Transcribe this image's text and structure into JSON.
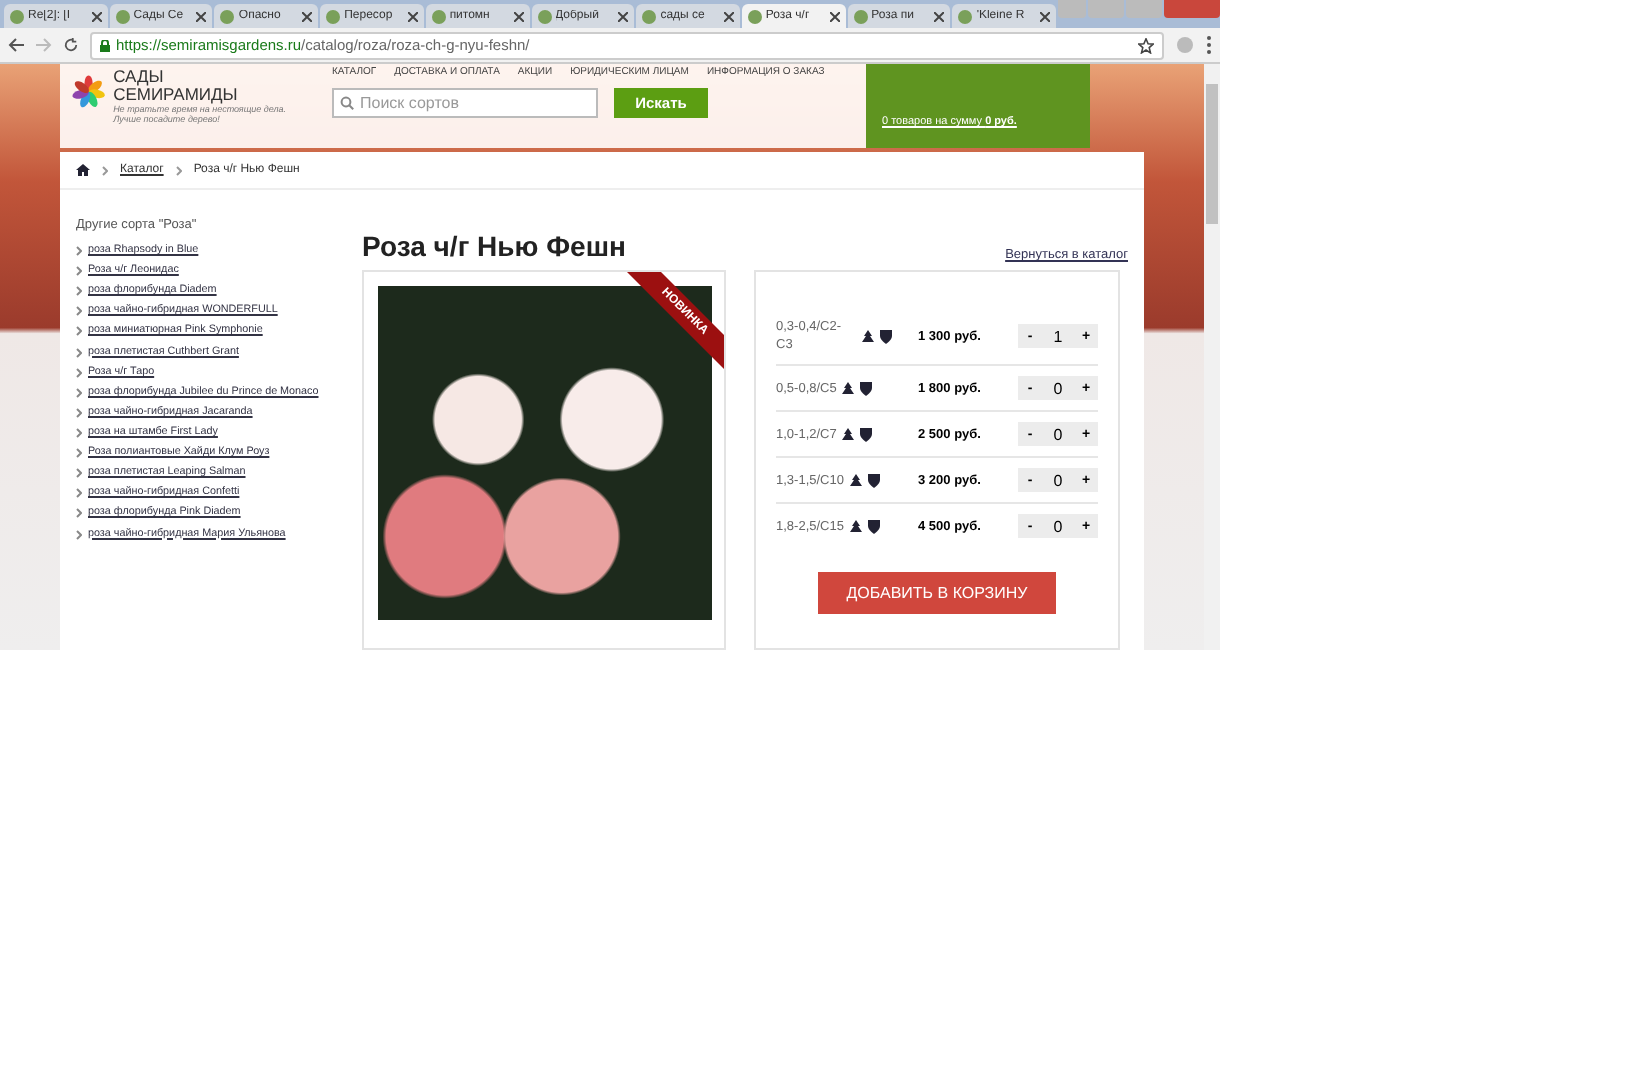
{
  "browser": {
    "tabs": [
      {
        "title": "Re[2]: [І",
        "selected": false
      },
      {
        "title": "Сады Се",
        "selected": false
      },
      {
        "title": "Опасно",
        "selected": false
      },
      {
        "title": "Пересор",
        "selected": false
      },
      {
        "title": "питомн",
        "selected": false
      },
      {
        "title": "Добрый",
        "selected": false
      },
      {
        "title": "сады се",
        "selected": false
      },
      {
        "title": "Роза ч/г",
        "selected": true
      },
      {
        "title": "Роза пи",
        "selected": false
      },
      {
        "title": "'Kleine R",
        "selected": false
      }
    ],
    "url": {
      "host": "https://semiramisgardens.ru",
      "path": "/catalog/roza/roza-ch-g-nyu-feshn/"
    }
  },
  "site_header": {
    "logo_title": "САДЫ СЕМИРАМИДЫ",
    "slogan": "Не тратьте время на нестоящие дела. Лучше посадите дерево!",
    "nav": [
      "КАТАЛОГ",
      "ДОСТАВКА И ОПЛАТА",
      "АКЦИИ",
      "ЮРИДИЧЕСКИМ ЛИЦАМ",
      "ИНФОРМАЦИЯ О ЗАКАЗ"
    ],
    "search": {
      "placeholder": "Поиск сортов",
      "button": "Искать"
    },
    "cart": {
      "summary": "0 товаров на сумму **0 руб.**"
    }
  },
  "breadcrumbs": [
    {
      "label": "Каталог",
      "link": true
    },
    {
      "label": "Роза ч/г Нью Фешн",
      "link": false
    }
  ],
  "sidebar": {
    "title": "Другие сорта \"Роза\"",
    "items": [
      "роза Rhapsody in Blue",
      "Роза ч/г Леонидас",
      "роза флорибунда Diadem",
      "роза чайно-гибридная WONDERFULL",
      "роза миниатюрная Pink Symphonie",
      "роза плетистая Cuthbert Grant",
      "Роза ч/г Таро",
      "роза флорибунда Jubilee du Prince de Monaco",
      "роза чайно-гибридная Jacaranda",
      "роза на штамбе First Lady",
      "Роза полиантовые Хайди Клум Роуз",
      "роза плетистая Leaping Salman",
      "роза чайно-гибридная Confetti",
      "роза флорибунда Pink Diadem",
      "роза чайно-гибридная Мария Ульянова"
    ]
  },
  "product": {
    "title": "Роза ч/г Нью Фешн",
    "back_link": "Вернуться в каталог",
    "badge": "НОВИНКА",
    "variants": [
      {
        "size": "0,3-0,4/C2-C3",
        "price": "1 300 руб.",
        "minus": "-",
        "qty": "1",
        "plus": "+"
      },
      {
        "size": "0,5-0,8/C5",
        "price": "1 800 руб.",
        "minus": "-",
        "qty": "0",
        "plus": "+"
      },
      {
        "size": "1,0-1,2/C7",
        "price": "2 500 руб.",
        "minus": "-",
        "qty": "0",
        "plus": "+"
      },
      {
        "size": "1,3-1,5/C10",
        "price": "3 200 руб.",
        "minus": "-",
        "qty": "0",
        "plus": "+"
      },
      {
        "size": "1,8-2,5/C15",
        "price": "4 500 руб.",
        "minus": "-",
        "qty": "0",
        "plus": "+"
      }
    ],
    "add_button": "ДОБАВИТЬ В КОРЗИНУ"
  }
}
